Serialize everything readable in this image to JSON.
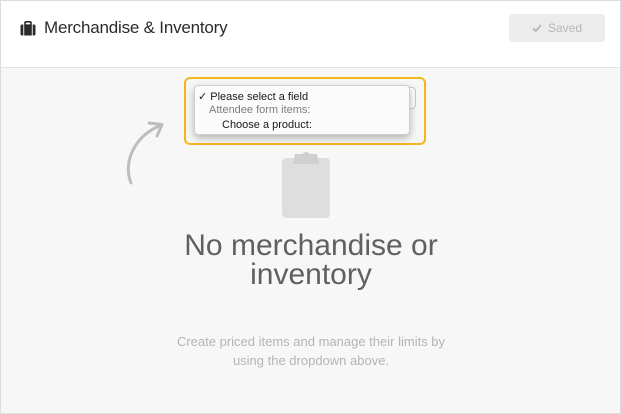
{
  "header": {
    "title": "Merchandise & Inventory",
    "icon": "briefcase-icon",
    "saved_label": "Saved"
  },
  "field_select": {
    "options": [
      {
        "label": "✓ Please select a field",
        "selected": true
      },
      {
        "label": "Attendee form items:",
        "group": true
      },
      {
        "label": "Choose a product:"
      }
    ],
    "highlight_color": "#f5b51d"
  },
  "empty_state": {
    "title": "No merchandise or inventory",
    "description": "Create priced items and manage their limits by using the dropdown above."
  },
  "colors": {
    "accent": "#f5b51d",
    "background": "#f7f7f7",
    "header_bg": "#ffffff"
  }
}
